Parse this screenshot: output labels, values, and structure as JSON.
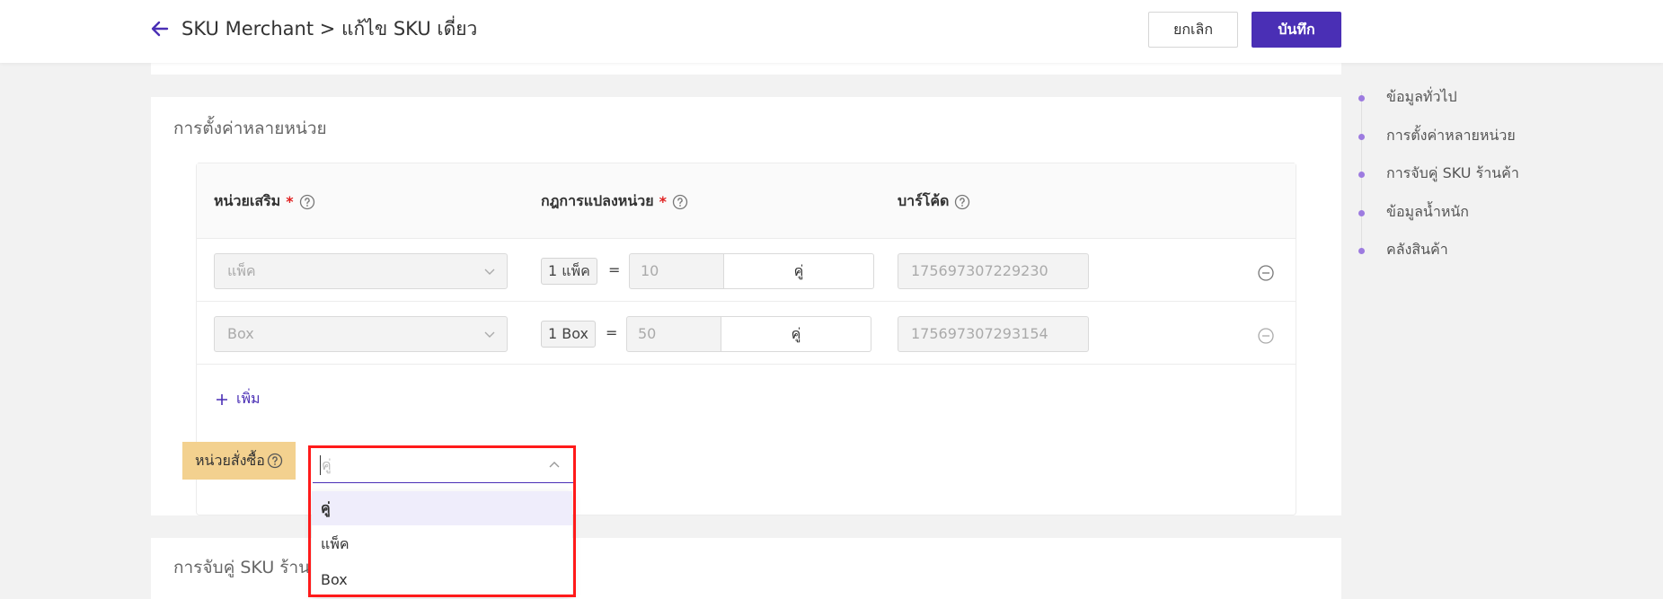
{
  "header": {
    "breadcrumb": "SKU Merchant > แก้ไข SKU เดี่ยว",
    "cancel_label": "ยกเลิก",
    "save_label": "บันทึก"
  },
  "multi_unit": {
    "title": "การตั้งค่าหลายหน่วย",
    "columns": {
      "extra_unit": "หน่วยเสริม",
      "conversion_rule": "กฎการแปลงหน่วย",
      "barcode": "บาร์โค้ด",
      "required_mark": "*"
    },
    "rows": [
      {
        "unit": "แพ็ค",
        "ratio_tag": "1 แพ็ค",
        "equals": "=",
        "quantity": "10",
        "base_unit": "คู่",
        "barcode": "175697307229230"
      },
      {
        "unit": "Box",
        "ratio_tag": "1 Box",
        "equals": "=",
        "quantity": "50",
        "base_unit": "คู่",
        "barcode": "175697307293154"
      }
    ],
    "add_label": "เพิ่ม",
    "order_unit": {
      "label": "หน่วยสั่งซื้อ",
      "placeholder": "คู่",
      "options": [
        "คู่",
        "แพ็ค",
        "Box"
      ],
      "selected": "คู่"
    }
  },
  "sku_mapping": {
    "title": "การจับคู่ SKU ร้าน"
  },
  "side_nav": {
    "items": [
      "ข้อมูลทั่วไป",
      "การตั้งค่าหลายหน่วย",
      "การจับคู่ SKU ร้านค้า",
      "ข้อมูลน้ำหนัก",
      "คลังสินค้า"
    ]
  },
  "colors": {
    "brand": "#4a2fb5",
    "highlight": "#ff1a1a",
    "label_bg": "#f3d18f",
    "nav_dot": "#9d7be0"
  }
}
